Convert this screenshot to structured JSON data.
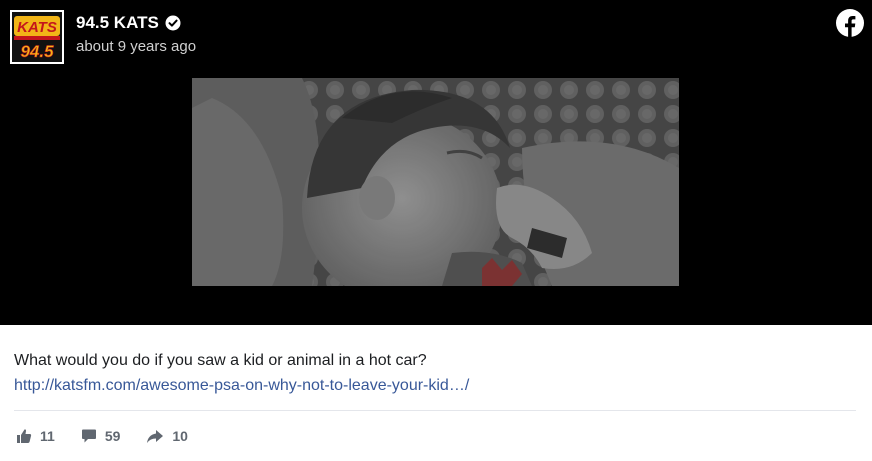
{
  "post": {
    "page_name": "94.5 KATS",
    "timestamp": "about 9 years ago",
    "avatar_text_top": "KATS",
    "avatar_text_bottom": "94.5",
    "text": "What would you do if you saw a kid or animal in a hot car?",
    "link": "http://katsfm.com/awesome-psa-on-why-not-to-leave-your-kid…/",
    "likes": "11",
    "comments": "59",
    "shares": "10"
  },
  "colors": {
    "link": "#385898",
    "video_bg": "#000000",
    "icon_gray": "#606770"
  },
  "icons": {
    "verified": "verified-badge-icon",
    "facebook": "facebook-logo-icon",
    "like": "thumbs-up-icon",
    "comment": "comment-bubble-icon",
    "share": "share-arrow-icon"
  }
}
